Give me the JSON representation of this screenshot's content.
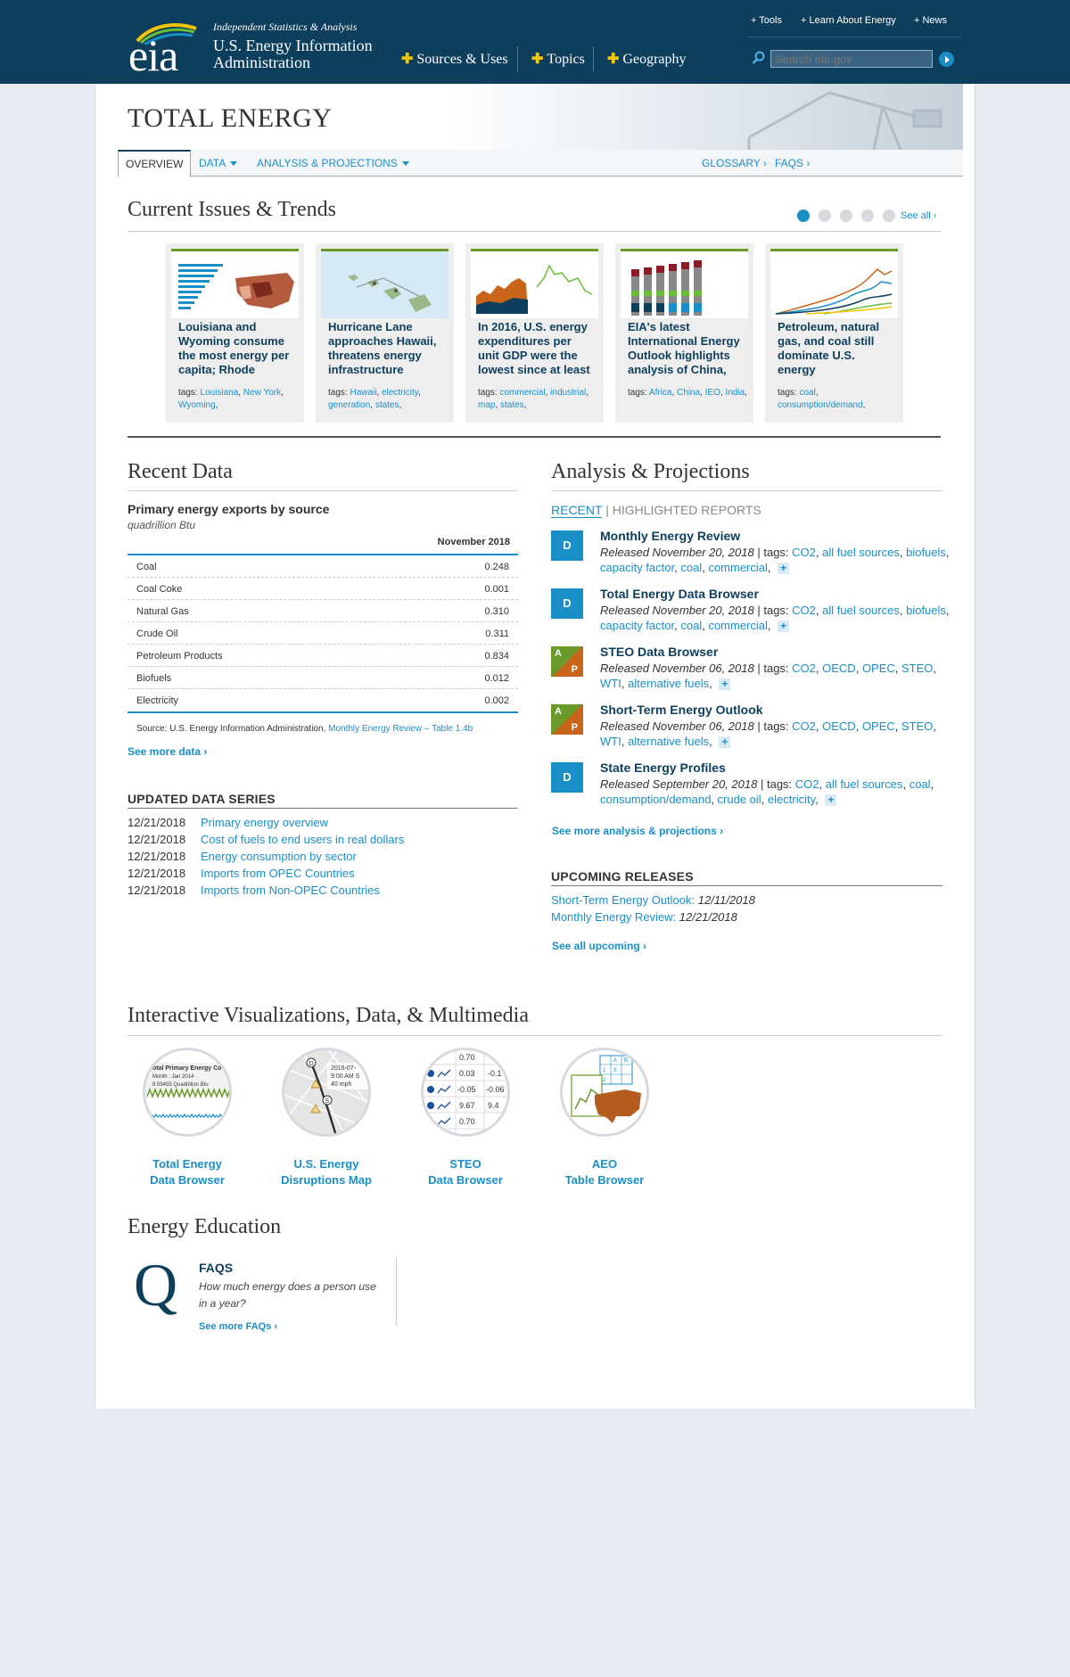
{
  "header": {
    "logo_text": "eia",
    "tagline": "Independent Statistics & Analysis",
    "org_line1": "U.S. Energy Information",
    "org_line2": "Administration",
    "main_nav": [
      {
        "label": "Sources & Uses"
      },
      {
        "label": "Topics"
      },
      {
        "label": "Geography"
      }
    ],
    "util_nav": [
      {
        "label": "Tools"
      },
      {
        "label": "Learn About Energy"
      },
      {
        "label": "News"
      }
    ],
    "search_placeholder": "Search eia.gov",
    "colors": {
      "bar": "#0d3e5c",
      "accent": "#f2c500",
      "link": "#1a8fc7"
    }
  },
  "page": {
    "title": "TOTAL ENERGY",
    "subnav": {
      "overview": "OVERVIEW",
      "data": "DATA",
      "analysis": "ANALYSIS & PROJECTIONS",
      "glossary": "GLOSSARY",
      "faqs": "FAQS"
    }
  },
  "trends": {
    "heading": "Current Issues & Trends",
    "see_all": "See all",
    "active_dot": 0,
    "dots": 5,
    "cards": [
      {
        "title": "Louisiana and Wyoming consume the most energy per capita; Rhode",
        "tags_label": "tags:",
        "tags": [
          "Louisiana",
          "New York",
          "Wyoming"
        ]
      },
      {
        "title": "Hurricane Lane approaches Hawaii, threatens energy infrastructure",
        "tags_label": "tags:",
        "tags": [
          "Hawaii",
          "electricity",
          "generation",
          "states"
        ]
      },
      {
        "title": "In 2016, U.S. energy expenditures per unit GDP were the lowest since at least",
        "tags_label": "tags:",
        "tags": [
          "commercial",
          "industrial",
          "map",
          "states"
        ]
      },
      {
        "title": "EIA's latest International Energy Outlook highlights analysis of China,",
        "tags_label": "tags:",
        "tags": [
          "Africa",
          "China",
          "IEO",
          "India"
        ]
      },
      {
        "title": "Petroleum, natural gas, and coal still dominate U.S. energy",
        "tags_label": "tags:",
        "tags": [
          "coal",
          "consumption/demand"
        ]
      }
    ]
  },
  "recent_data": {
    "heading": "Recent Data",
    "subtitle": "Primary energy exports by source",
    "unit": "quadrillion Btu",
    "column": "November 2018",
    "rows": [
      {
        "name": "Coal",
        "value": "0.248"
      },
      {
        "name": "Coal Coke",
        "value": "0.001"
      },
      {
        "name": "Natural Gas",
        "value": "0.310"
      },
      {
        "name": "Crude Oil",
        "value": "0.311"
      },
      {
        "name": "Petroleum Products",
        "value": "0.834"
      },
      {
        "name": "Biofuels",
        "value": "0.012"
      },
      {
        "name": "Electricity",
        "value": "0.002"
      }
    ],
    "source_label": "Source: U.S. Energy Information Administration,",
    "source_link": "Monthly Energy Review – Table 1.4b",
    "see_more": "See more data"
  },
  "updated_series": {
    "heading": "UPDATED DATA SERIES",
    "items": [
      {
        "date": "12/21/2018",
        "label": "Primary energy overview"
      },
      {
        "date": "12/21/2018",
        "label": "Cost of fuels to end users in real dollars"
      },
      {
        "date": "12/21/2018",
        "label": "Energy consumption by sector"
      },
      {
        "date": "12/21/2018",
        "label": "Imports from OPEC Countries"
      },
      {
        "date": "12/21/2018",
        "label": "Imports from Non-OPEC Countries"
      }
    ]
  },
  "analysis": {
    "heading": "Analysis & Projections",
    "tab_recent": "RECENT",
    "tab_sep": "|",
    "tab_highlighted": "HIGHLIGHTED REPORTS",
    "items": [
      {
        "badge": "D",
        "title": "Monthly Energy Review",
        "released": "Released November 20, 2018",
        "tags_label": "| tags:",
        "tags": [
          "CO2",
          "all fuel sources",
          "biofuels",
          "capacity factor",
          "coal",
          "commercial"
        ]
      },
      {
        "badge": "D",
        "title": "Total Energy Data Browser",
        "released": "Released November 20, 2018",
        "tags_label": "| tags:",
        "tags": [
          "CO2",
          "all fuel sources",
          "biofuels",
          "capacity factor",
          "coal",
          "commercial"
        ]
      },
      {
        "badge": "AP",
        "badge_a": "A",
        "badge_p": "P",
        "title": "STEO Data Browser",
        "released": "Released November 06, 2018",
        "tags_label": "| tags:",
        "tags": [
          "CO2",
          "OECD",
          "OPEC",
          "STEO",
          "WTI",
          "alternative fuels"
        ]
      },
      {
        "badge": "AP",
        "badge_a": "A",
        "badge_p": "P",
        "title": "Short-Term Energy Outlook",
        "released": "Released November 06, 2018",
        "tags_label": "| tags:",
        "tags": [
          "CO2",
          "OECD",
          "OPEC",
          "STEO",
          "WTI",
          "alternative fuels"
        ]
      },
      {
        "badge": "D",
        "title": "State Energy Profiles",
        "released": "Released September 20, 2018",
        "tags_label": "| tags:",
        "tags": [
          "CO2",
          "all fuel sources",
          "coal",
          "consumption/demand",
          "crude oil",
          "electricity"
        ]
      }
    ],
    "see_more": "See more analysis & projections"
  },
  "upcoming": {
    "heading": "UPCOMING RELEASES",
    "items": [
      {
        "label": "Short-Term Energy Outlook:",
        "date": "12/11/2018"
      },
      {
        "label": "Monthly Energy Review:",
        "date": "12/21/2018"
      }
    ],
    "see_all": "See all upcoming"
  },
  "visualizations": {
    "heading": "Interactive Visualizations, Data, & Multimedia",
    "items": [
      {
        "line1": "Total Energy",
        "line2": "Data Browser",
        "thumb_text1": "otal Primary Energy Co",
        "thumb_text2": "Month : Jan 2014",
        "thumb_text3": "8.59455 Quadrillion Btu"
      },
      {
        "line1": "U.S. Energy",
        "line2": "Disruptions Map",
        "thumb_text1": "2016-07-",
        "thumb_text2": "9:00 AM S",
        "thumb_text3": "40 mph"
      },
      {
        "line1": "STEO",
        "line2": "Data Browser",
        "thumb_values": [
          "0.70",
          "0.03",
          "-0.1",
          "-0.05",
          "-0.06",
          "9.67",
          "9.4",
          "0.70"
        ]
      },
      {
        "line1": "AEO",
        "line2": "Table Browser",
        "thumb_values": [
          "A",
          "B",
          "1",
          "2",
          "3"
        ]
      }
    ]
  },
  "education": {
    "heading": "Energy Education",
    "icon": "Q",
    "faq_heading": "FAQS",
    "faq_question": "How much energy does a person use in a year?",
    "see_more": "See more FAQs"
  }
}
